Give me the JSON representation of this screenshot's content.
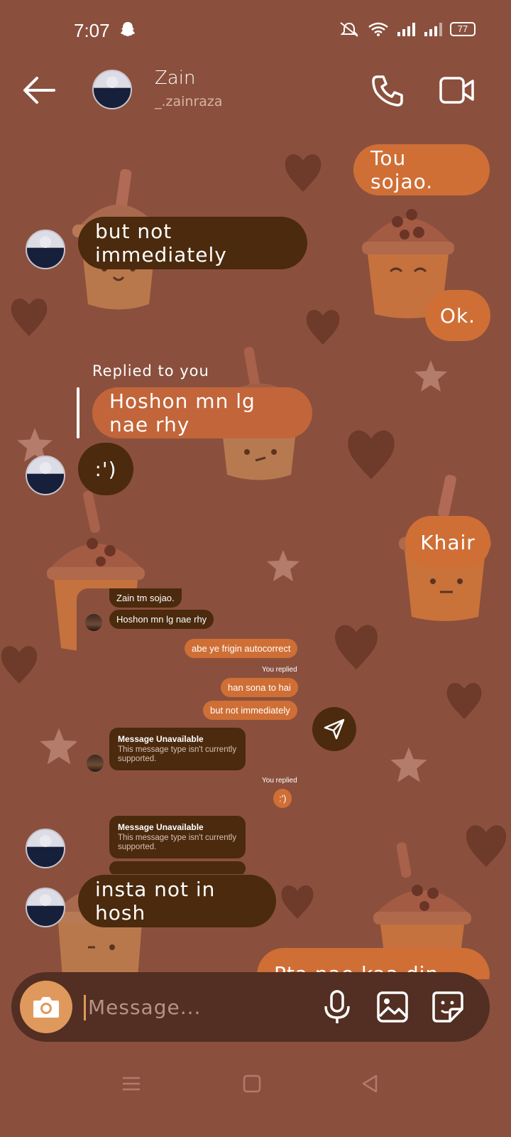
{
  "status_bar": {
    "time": "7:07",
    "battery": "77"
  },
  "header": {
    "contact_name": "Zain",
    "contact_handle": "_.zainraza"
  },
  "messages": {
    "m1": "Tou sojao.",
    "m2": "but not immediately",
    "m3": "Ok.",
    "replied_label": "Replied to you",
    "m4": "Hoshon mn lg nae rhy",
    "m5": ":')",
    "m6": "Khair",
    "m7": "insta not in hosh",
    "m8": "Pta nae kaa din tha"
  },
  "shared_screenshot": {
    "b1": "Zain tm sojao.",
    "b2": "Hoshon mn lg nae rhy",
    "b3": "abe ye frigin autocorrect",
    "you_replied_1": "You replied",
    "b4": "han sona to hai",
    "b5": "but not immediately",
    "unavailable_title": "Message Unavailable",
    "unavailable_sub": "This message type isn't currently supported.",
    "you_replied_2": "You replied",
    "b6": ":')"
  },
  "composer": {
    "placeholder": "Message..."
  },
  "colors": {
    "background": "#8a503d",
    "outgoing": "#cf6f36",
    "incoming": "#4b2a0d",
    "composer": "#522f22",
    "camera": "#e0995c"
  }
}
